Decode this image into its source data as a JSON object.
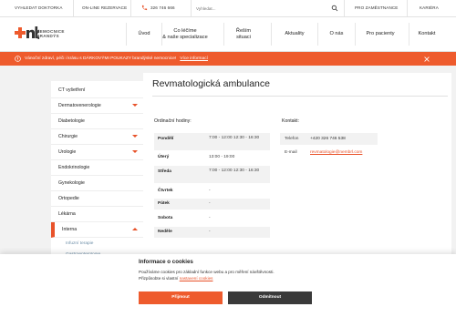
{
  "topbar": {
    "search_doctor": "VYHLEDAT DOKTORKA",
    "online_booking": "ON-LINE REZERVACE",
    "phone": "326 746 666",
    "search_placeholder": "Vyhledat...",
    "for_employees": "PRO ZAMĚSTNANCE",
    "career": "KARIÉRA"
  },
  "logo": {
    "mark": "+nb",
    "line1": "NEMOCNICE",
    "line2": "BRANDÝS"
  },
  "nav": [
    {
      "line1": "Úvod",
      "line2": ""
    },
    {
      "line1": "Co léčíme",
      "line2": "& naše specializace"
    },
    {
      "line1": "Řeším",
      "line2": "situaci"
    },
    {
      "line1": "Aktuality",
      "line2": ""
    },
    {
      "line1": "O nás",
      "line2": ""
    },
    {
      "line1": "Pro pacienty",
      "line2": ""
    },
    {
      "line1": "Kontakt",
      "line2": ""
    }
  ],
  "banner": {
    "message": "Vánoční zdraví, péči i krásu s DÁRKOVÝMI POUKAZY brandýské nemocnice!",
    "link": "Více informací"
  },
  "sidebar": {
    "items": [
      {
        "label": "CT vyšetření"
      },
      {
        "label": "Dermatovenerologie"
      },
      {
        "label": "Diabetologie"
      },
      {
        "label": "Chirurgie"
      },
      {
        "label": "Urologie"
      },
      {
        "label": "Endokrinologie"
      },
      {
        "label": "Gynekologie"
      },
      {
        "label": "Ortopedie"
      },
      {
        "label": "Lékárna"
      },
      {
        "label": "Interna"
      }
    ],
    "subitems": [
      {
        "label": "Infuzní terapie"
      },
      {
        "label": "Gastroenterologie"
      }
    ]
  },
  "main": {
    "title": "Revmatologická ambulance",
    "hours_heading": "Ordinační hodiny:",
    "contact_heading": "Kontakt:",
    "hours": [
      {
        "day": "Pondělí",
        "time": "7:00 - 12:00 12:30 - 16:30"
      },
      {
        "day": "Úterý",
        "time": "13:00 - 19:00"
      },
      {
        "day": "Středa",
        "time": "7:00 - 12:00 12:30 - 16:30"
      },
      {
        "day": "Čtvrtek",
        "time": "-"
      },
      {
        "day": "Pátek",
        "time": "-"
      },
      {
        "day": "Sobota",
        "time": "-"
      },
      {
        "day": "Neděle",
        "time": "-"
      }
    ],
    "contact": {
      "phone_label": "Telefon",
      "phone": "+420 326 746 538",
      "email_label": "E-mail",
      "email": "revmatologie@nembrl.com"
    }
  },
  "cookie": {
    "title": "Informace o cookies",
    "line1": "Používáme cookies pro základní funkce webu a pro měření návštěvnosti.",
    "line2_prefix": "Přizpůsobte si vlastní",
    "line2_link": "nastavení cookies",
    "accept": "Přijmout",
    "reject": "Odmítnout"
  },
  "colors": {
    "accent": "#ee5b2d",
    "dark_button": "#3a3a3a",
    "link": "#e8522a"
  }
}
